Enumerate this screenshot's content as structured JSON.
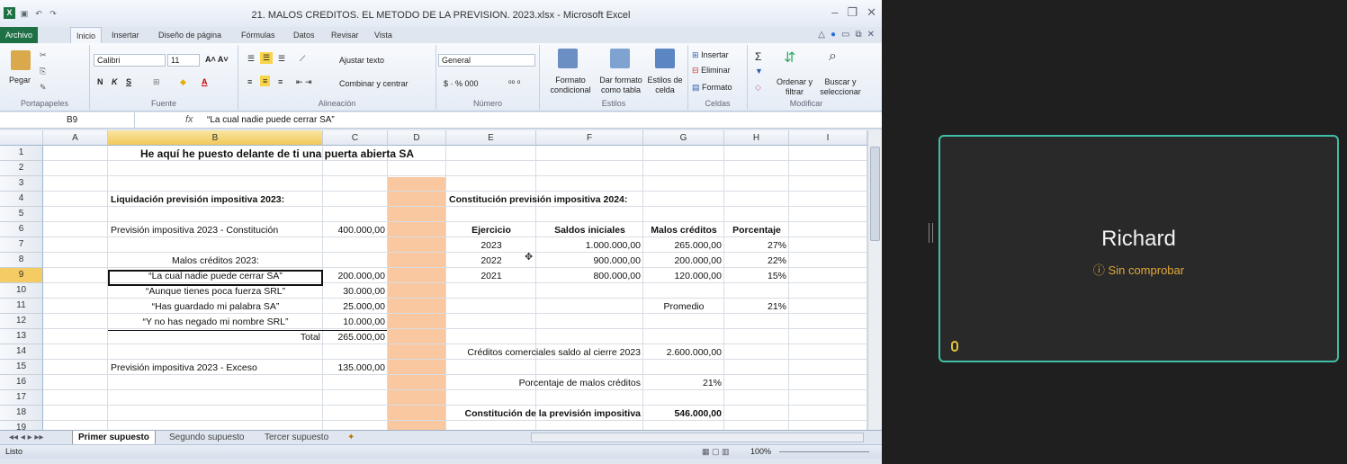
{
  "window": {
    "title": "21. MALOS CREDITOS. EL METODO DE LA PREVISION. 2023.xlsx - Microsoft Excel"
  },
  "menu": {
    "tabs": [
      "Archivo",
      "Inicio",
      "Insertar",
      "Diseño de página",
      "Fórmulas",
      "Datos",
      "Revisar",
      "Vista"
    ]
  },
  "ribbon": {
    "paste": "Pegar",
    "font_name": "Calibri",
    "font_size": "11",
    "wrap_text": "Ajustar texto",
    "merge_center": "Combinar y centrar",
    "number_format": "General",
    "cond_format": "Formato condicional",
    "format_table": "Dar formato como tabla",
    "cell_styles": "Estilos de celda",
    "insert": "Insertar",
    "delete": "Eliminar",
    "format": "Formato",
    "sort_filter": "Ordenar y filtrar",
    "find_select": "Buscar y seleccionar",
    "groups": [
      "Portapapeles",
      "Fuente",
      "Alineación",
      "Número",
      "Estilos",
      "Celdas",
      "Modificar"
    ]
  },
  "formula_bar": {
    "name_box": "B9",
    "fx": "fx",
    "content": "“La cual nadie puede cerrar SA”"
  },
  "columns": [
    "A",
    "B",
    "C",
    "D",
    "E",
    "F",
    "G",
    "H",
    "I"
  ],
  "rows": [
    "1",
    "2",
    "3",
    "4",
    "5",
    "6",
    "7",
    "8",
    "9",
    "10",
    "11",
    "12",
    "13",
    "14",
    "15",
    "16",
    "17",
    "18",
    "19"
  ],
  "cells": {
    "B1": "He aquí he puesto delante de ti una puerta abierta SA",
    "B4": "Liquidación previsión impositiva 2023:",
    "E4": "Constitución previsión impositiva 2024:",
    "B6": "Previsión impositiva 2023 - Constitución",
    "C6": "400.000,00",
    "E6": "Ejercicio",
    "F6": "Saldos iniciales",
    "G6": "Malos créditos",
    "H6": "Porcentaje",
    "E7": "2023",
    "F7": "1.000.000,00",
    "G7": "265.000,00",
    "H7": "27%",
    "B8": "Malos créditos 2023:",
    "E8": "2022",
    "F8": "900.000,00",
    "G8": "200.000,00",
    "H8": "22%",
    "B9": "“La cual nadie puede cerrar SA”",
    "C9": "200.000,00",
    "E9": "2021",
    "F9": "800.000,00",
    "G9": "120.000,00",
    "H9": "15%",
    "B10": "“Aunque tienes poca fuerza SRL”",
    "C10": "30.000,00",
    "B11": "“Has guardado mi palabra SA”",
    "C11": "25.000,00",
    "G11": "Promedio",
    "H11": "21%",
    "B12": "“Y no has negado mi nombre SRL”",
    "C12": "10.000,00",
    "B13": "Total",
    "C13": "265.000,00",
    "E14": "Créditos comerciales saldo al cierre 2023",
    "G14": "2.600.000,00",
    "B15": "Previsión impositiva 2023 - Exceso",
    "C15": "135.000,00",
    "E16": "Porcentaje de malos créditos",
    "G16": "21%",
    "E18": "Constitución de la previsión impositiva",
    "G18": "546.000,00"
  },
  "sheets": [
    "Primer supuesto",
    "Segundo supuesto",
    "Tercer supuesto"
  ],
  "status": {
    "mode": "Listo",
    "zoom": "100%"
  },
  "participant": {
    "name": "Richard",
    "status": "Sin comprobar"
  }
}
